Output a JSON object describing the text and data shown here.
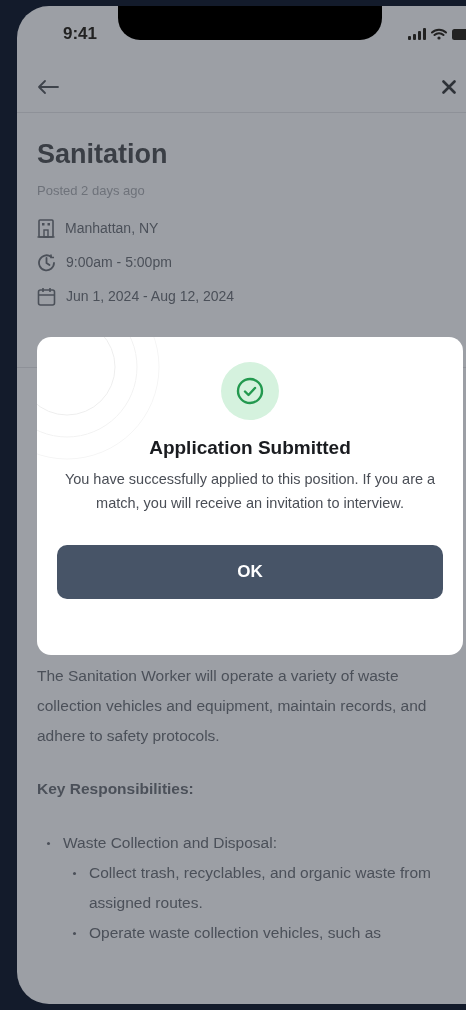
{
  "status_bar": {
    "time": "9:41"
  },
  "job": {
    "title": "Sanitation",
    "posted": "Posted 2 days ago",
    "details": [
      {
        "kind": "location",
        "text": "Manhattan, NY"
      },
      {
        "kind": "time",
        "text": "9:00am - 5:00pm"
      },
      {
        "kind": "date",
        "text": "Jun 1, 2024 - Aug 12, 2024"
      }
    ],
    "description": "The Sanitation Worker will operate a variety of waste collection vehicles and equipment, maintain records, and adhere to safety protocols.",
    "responsibilities_heading": "Key Responsibilities:",
    "responsibilities": [
      {
        "text": "Waste Collection and Disposal:",
        "children": [
          {
            "text": "Collect trash, recyclables, and organic waste from assigned routes."
          },
          {
            "text": "Operate waste collection vehicles, such as"
          }
        ]
      }
    ]
  },
  "dialog": {
    "title": "Application Submitted",
    "message": "You have successfully applied to this position. If you are a match, you will receive an invitation to interview.",
    "button": "OK"
  }
}
